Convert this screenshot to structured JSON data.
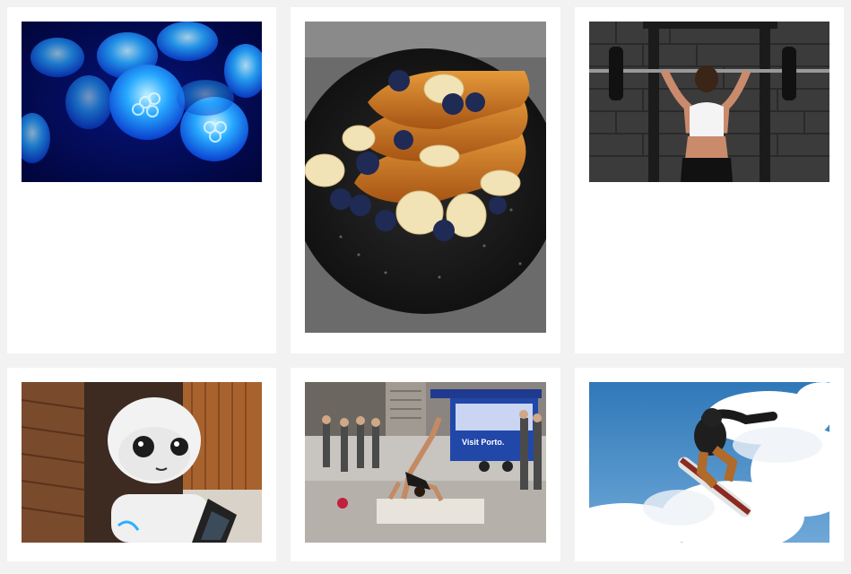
{
  "gallery": {
    "items": [
      {
        "subject": "jellyfish"
      },
      {
        "subject": "french-toast"
      },
      {
        "subject": "weightlifter"
      },
      {
        "subject": "robot"
      },
      {
        "subject": "breakdancer"
      },
      {
        "subject": "snowboarder"
      }
    ],
    "street_sign_text": "Visit Porto."
  },
  "colors": {
    "page_background": "#f2f2f2",
    "card_background": "#ffffff"
  }
}
